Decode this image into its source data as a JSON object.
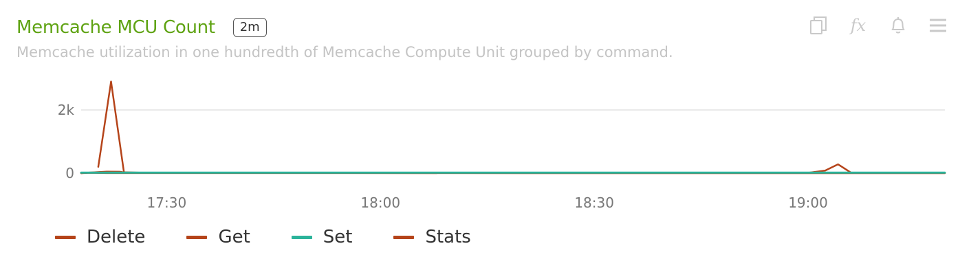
{
  "header": {
    "title": "Memcache MCU Count",
    "badge": "2m",
    "subtitle": "Memcache utilization in one hundredth of Memcache Compute Unit grouped by command."
  },
  "toolbar": {
    "icons": [
      "copy-icon",
      "fx-icon",
      "bell-icon",
      "menu-icon"
    ],
    "fx_label": "fx"
  },
  "chart_data": {
    "type": "line",
    "ylim": [
      0,
      2900
    ],
    "y_ticks": [
      {
        "value": 0,
        "label": "0"
      },
      {
        "value": 2000,
        "label": "2k"
      }
    ],
    "x_ticks": [
      {
        "value": 17.5,
        "label": "17:30"
      },
      {
        "value": 18.0,
        "label": "18:00"
      },
      {
        "value": 18.5,
        "label": "18:30"
      },
      {
        "value": 19.0,
        "label": "19:00"
      }
    ],
    "xlim": [
      17.3,
      19.32
    ],
    "grid": true,
    "series": [
      {
        "name": "Delete",
        "color": "#b5441a",
        "x": [
          17.3,
          17.32,
          17.36,
          17.39,
          17.42,
          19.32
        ],
        "y": [
          0,
          10,
          2,
          2,
          2,
          0
        ]
      },
      {
        "name": "Get",
        "color": "#b5441a",
        "x": [
          17.34,
          17.37,
          17.4,
          17.45,
          18.0,
          18.5,
          19.0,
          19.04,
          19.07,
          19.1,
          19.15,
          19.32
        ],
        "y": [
          200,
          2900,
          30,
          10,
          10,
          10,
          10,
          80,
          280,
          20,
          10,
          10
        ]
      },
      {
        "name": "Set",
        "color": "#2bb39a",
        "x": [
          17.3,
          17.5,
          18.0,
          18.5,
          19.0,
          19.32
        ],
        "y": [
          15,
          15,
          15,
          15,
          15,
          15
        ]
      },
      {
        "name": "Stats",
        "color": "#b5441a",
        "x": [
          17.3,
          17.32,
          17.36,
          17.39,
          17.41,
          19.32
        ],
        "y": [
          0,
          20,
          50,
          45,
          5,
          5
        ]
      }
    ]
  }
}
